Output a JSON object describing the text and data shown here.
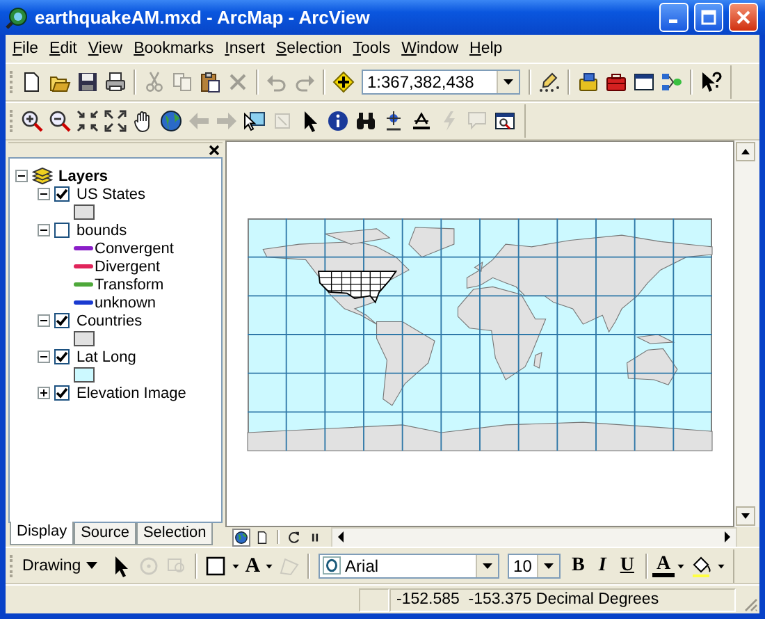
{
  "window": {
    "title": "earthquakeAM.mxd - ArcMap - ArcView"
  },
  "menu": [
    "File",
    "Edit",
    "View",
    "Bookmarks",
    "Insert",
    "Selection",
    "Tools",
    "Window",
    "Help"
  ],
  "standard_toolbar": [
    {
      "kind": "new",
      "disabled": false
    },
    {
      "kind": "open",
      "disabled": false
    },
    {
      "kind": "save",
      "disabled": false
    },
    {
      "kind": "print",
      "disabled": false
    },
    {
      "kind": "sep"
    },
    {
      "kind": "cut",
      "disabled": true
    },
    {
      "kind": "copy",
      "disabled": true
    },
    {
      "kind": "paste",
      "disabled": false
    },
    {
      "kind": "delete",
      "disabled": true
    },
    {
      "kind": "sep"
    },
    {
      "kind": "undo",
      "disabled": true
    },
    {
      "kind": "redo",
      "disabled": true
    },
    {
      "kind": "sep"
    },
    {
      "kind": "add",
      "disabled": false
    },
    {
      "kind": "scale",
      "value": "1:367,382,438"
    },
    {
      "kind": "sep"
    },
    {
      "kind": "editor",
      "disabled": false
    },
    {
      "kind": "sep"
    },
    {
      "kind": "cabinet",
      "disabled": false
    },
    {
      "kind": "toolbox",
      "disabled": false
    },
    {
      "kind": "command",
      "disabled": false
    },
    {
      "kind": "model",
      "disabled": false
    },
    {
      "kind": "sep"
    },
    {
      "kind": "help",
      "disabled": false
    }
  ],
  "tools_toolbar": [
    {
      "kind": "zoom-in",
      "disabled": false
    },
    {
      "kind": "zoom-out",
      "disabled": false
    },
    {
      "kind": "fixed-in",
      "disabled": false
    },
    {
      "kind": "fixed-out",
      "disabled": false
    },
    {
      "kind": "pan",
      "disabled": false
    },
    {
      "kind": "globe",
      "disabled": false
    },
    {
      "kind": "back",
      "disabled": true
    },
    {
      "kind": "forward",
      "disabled": true
    },
    {
      "kind": "select-features",
      "disabled": false
    },
    {
      "kind": "clear-selection",
      "disabled": true
    },
    {
      "kind": "pointer",
      "disabled": false
    },
    {
      "kind": "identify",
      "disabled": false
    },
    {
      "kind": "find",
      "disabled": false
    },
    {
      "kind": "goto-xy",
      "disabled": false
    },
    {
      "kind": "measure",
      "disabled": false
    },
    {
      "kind": "hyperlink",
      "disabled": true
    },
    {
      "kind": "popup",
      "disabled": true
    },
    {
      "kind": "viewer",
      "disabled": false
    }
  ],
  "toc": {
    "root": {
      "label": "Layers",
      "expanded": true
    },
    "layers": [
      {
        "label": "US States",
        "checked": true,
        "expanded": true,
        "legend": [
          {
            "kind": "swatch",
            "color": "#e1e1e1"
          }
        ]
      },
      {
        "label": "bounds",
        "checked": false,
        "expanded": true,
        "legend": [
          {
            "kind": "line",
            "color": "#8a1ec8",
            "label": "Convergent"
          },
          {
            "kind": "line",
            "color": "#e0245a",
            "label": "Divergent"
          },
          {
            "kind": "line",
            "color": "#4ea83a",
            "label": "Transform"
          },
          {
            "kind": "line",
            "color": "#1a3ad0",
            "label": "unknown"
          }
        ]
      },
      {
        "label": "Countries",
        "checked": true,
        "expanded": true,
        "legend": [
          {
            "kind": "swatch",
            "color": "#e1e1e1"
          }
        ]
      },
      {
        "label": "Lat Long",
        "checked": true,
        "expanded": true,
        "legend": [
          {
            "kind": "swatch",
            "color": "#ccf9ff"
          }
        ]
      },
      {
        "label": "Elevation Image",
        "checked": true,
        "expanded": false
      }
    ],
    "tabs": [
      {
        "label": "Display",
        "selected": true
      },
      {
        "label": "Source",
        "selected": false
      },
      {
        "label": "Selection",
        "selected": false
      }
    ]
  },
  "map_view": {
    "view_buttons": [
      {
        "kind": "data-view",
        "selected": true
      },
      {
        "kind": "layout-view",
        "selected": false
      },
      {
        "kind": "sep"
      },
      {
        "kind": "refresh",
        "selected": false
      },
      {
        "kind": "pause",
        "selected": false
      }
    ]
  },
  "drawing_toolbar": {
    "label": "Drawing",
    "items": [
      {
        "kind": "pointer",
        "disabled": false
      },
      {
        "kind": "rotate",
        "disabled": true
      },
      {
        "kind": "zoom-selected",
        "disabled": true
      },
      {
        "kind": "sep"
      },
      {
        "kind": "rectangle",
        "disabled": false
      },
      {
        "kind": "caret",
        "disabled": false
      },
      {
        "kind": "text",
        "label": "A"
      },
      {
        "kind": "caret",
        "disabled": false
      },
      {
        "kind": "edit-vertices",
        "disabled": true
      },
      {
        "kind": "sep"
      },
      {
        "kind": "font",
        "value": "Arial"
      },
      {
        "kind": "size",
        "value": "10"
      },
      {
        "kind": "bold",
        "label": "B"
      },
      {
        "kind": "italic",
        "label": "I"
      },
      {
        "kind": "underline",
        "label": "U"
      },
      {
        "kind": "sep"
      },
      {
        "kind": "font-color",
        "label": "A"
      },
      {
        "kind": "caret",
        "disabled": false
      },
      {
        "kind": "fill-color",
        "disabled": false
      },
      {
        "kind": "caret",
        "disabled": false
      }
    ]
  },
  "status_bar": {
    "coordinates": "-152.585  -153.375 Decimal Degrees"
  }
}
